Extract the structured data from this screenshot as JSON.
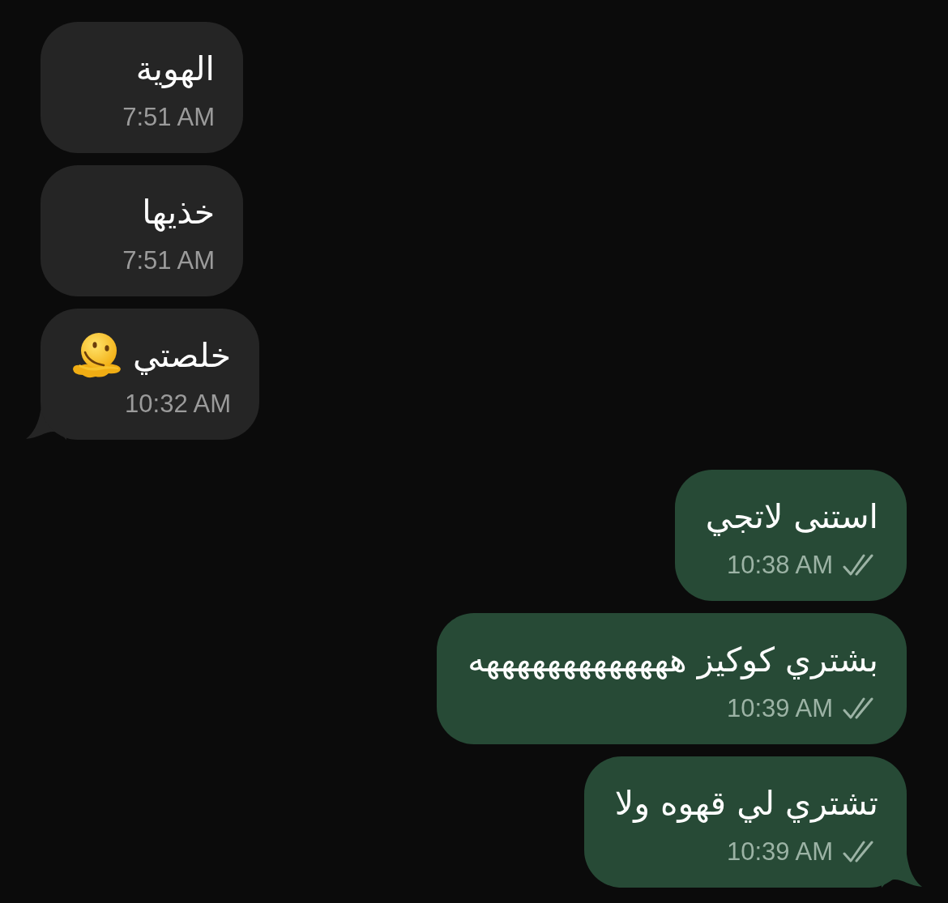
{
  "messages": [
    {
      "kind": "incoming",
      "text": "الهوية",
      "time": "7:51 AM",
      "emoji": false,
      "tail": false
    },
    {
      "kind": "incoming",
      "text": "خذيها",
      "time": "7:51 AM",
      "emoji": false,
      "tail": false
    },
    {
      "kind": "incoming",
      "text": "خلصتي",
      "time": "10:32 AM",
      "emoji": true,
      "tail": true
    },
    {
      "kind": "outgoing",
      "text": "استنى لاتجي",
      "time": "10:38 AM",
      "delivered": true,
      "emoji": false,
      "tail": false
    },
    {
      "kind": "outgoing",
      "text": "بشتري كوكيز هههههههههههههه",
      "time": "10:39 AM",
      "delivered": true,
      "emoji": false,
      "tail": false
    },
    {
      "kind": "outgoing",
      "text": "تشتري لي قهوه ولا",
      "time": "10:39 AM",
      "delivered": true,
      "emoji": false,
      "tail": true
    }
  ]
}
